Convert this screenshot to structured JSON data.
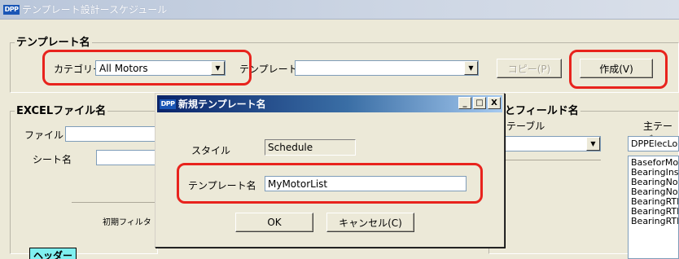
{
  "window": {
    "icon_text": "DPP",
    "title": "テンプレート設計ースケジュール"
  },
  "template_group": {
    "title": "テンプレート名",
    "category_label": "カテゴリー",
    "category_value": "All Motors",
    "template_label": "テンプレート",
    "template_value": "",
    "copy_button": "コピー(P)",
    "create_button": "作成(V)"
  },
  "excel_group": {
    "title": "EXCELファイル名",
    "file_label": "ファイル",
    "file_value": "",
    "sheet_label": "シート名",
    "sheet_value": "",
    "filter_tab": "初期フィルタ",
    "header_tag": "ヘッダー"
  },
  "table_field_group": {
    "title_partial": "とフィールド名",
    "table_label": "テーブル",
    "main_table_label": "主テーブ",
    "main_table_combo_value": "DPPElecLo",
    "field_list": [
      "BaseforMo",
      "BearingIns",
      "BearingNol",
      "BearingNol",
      "BearingRTI",
      "BearingRTI",
      "BearingRTI"
    ]
  },
  "dialog": {
    "icon_text": "DPP",
    "title": "新規テンプレート名",
    "minimize": "_",
    "maximize": "□",
    "close": "X",
    "style_label": "スタイル",
    "style_value": "Schedule",
    "name_label": "テンプレート名",
    "name_value": "MyMotorList",
    "ok_button": "OK",
    "cancel_button": "キャンセル(C)"
  },
  "colors": {
    "highlight": "#e8231d",
    "dialog_title_start": "#0a246a",
    "dialog_title_end": "#a6caf0",
    "window_bg": "#ece9d8"
  }
}
